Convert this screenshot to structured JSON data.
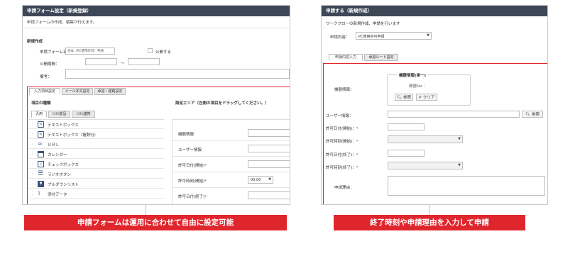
{
  "left": {
    "title": "申請フォーム設定（新規登録）",
    "subtitle": "申請フォームの作成、編集が行えます。",
    "section_heading": "新規作成",
    "form_name_label": "申請フォーム名：",
    "form_name_value": "見本（PC使用許可）申請",
    "public_label": "公開する",
    "period_label": "公開期間：",
    "tilde": "～",
    "remarks_label": "備考：",
    "tabs": [
      "入力項目設定",
      "メール本文設定",
      "承認・経路設定"
    ],
    "item_list_heading": "項目の種類",
    "sub_tabs": [
      "汎用",
      "ｼｽﾃﾑ部品",
      "ｼｽﾃﾑ連携"
    ],
    "items": [
      "テキストボックス",
      "テキストボックス（複数行）",
      "ＵＲＬ",
      "カレンダー",
      "チェックボックス",
      "ラジオボタン",
      "プルダウンリスト",
      "添付データ"
    ],
    "settings_area_heading": "設定エリア（左側の項目をドラッグしてください。）",
    "settings_fields": [
      "機器情報",
      "ユーザー情報",
      "許可日付(開始)",
      "許可時刻(開始)",
      "許可日付(終了)"
    ],
    "time_value": "00:00",
    "caption": "申請フォームは運用に合わせて自由に設定可能"
  },
  "right": {
    "title": "申請する（新規作成）",
    "subtitle": "ワークフローの新規作成、申請を行います",
    "applied_label": "申請内容：",
    "applied_value": "PC使用許可申請",
    "tabs": [
      "申請内容入力",
      "承認ルート設定"
    ],
    "device_info_label": "機器情報：",
    "device_group_title": "機器情報(単一)",
    "device_no_label": "機器No.：",
    "ref_button": "参照",
    "clear_button": "クリア",
    "user_info_label": "ユーザー情報：",
    "user_ref_button": "参照",
    "start_date_label": "許可日付(開始)：",
    "start_time_label": "許可時刻(開始)：",
    "end_date_label": "許可日付(終了)：",
    "end_time_label": "許可時刻(終了)：",
    "reason_label": "申請理由：",
    "required_mark": "*",
    "caption": "終了時刻や申請理由を入力して申請"
  },
  "colors": {
    "titlebar": "#3d4756",
    "accent_red": "#e0262d"
  }
}
